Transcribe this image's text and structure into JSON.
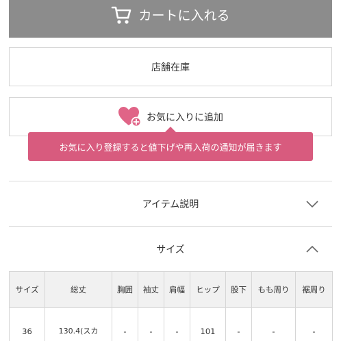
{
  "cart_button": {
    "label": "カートに入れる",
    "icon": "cart-icon"
  },
  "store_stock_button": {
    "label": "店舗在庫"
  },
  "favorite_button": {
    "label": "お気に入りに追加",
    "icon": "heart-plus-icon"
  },
  "favorite_tooltip": {
    "text": "お気に入り登録すると値下げや再入荷の通知が届きます"
  },
  "accordions": {
    "item_description": {
      "label": "アイテム説明",
      "state": "collapsed"
    },
    "size": {
      "label": "サイズ",
      "state": "expanded"
    }
  },
  "colors": {
    "cart_bg": "#8c8c8c",
    "accent_pink": "#d85b7e",
    "border": "#d6d6d6",
    "table_header_bg": "#f1f1f1"
  },
  "size_table": {
    "headers": [
      "サイズ",
      "総丈",
      "胸囲",
      "袖丈",
      "肩幅",
      "ヒップ",
      "股下",
      "もも周り",
      "裾周り"
    ],
    "rows": [
      [
        "36",
        "130.4(スカ",
        "-",
        "-",
        "-",
        "101",
        "-",
        "-",
        "-"
      ]
    ]
  }
}
